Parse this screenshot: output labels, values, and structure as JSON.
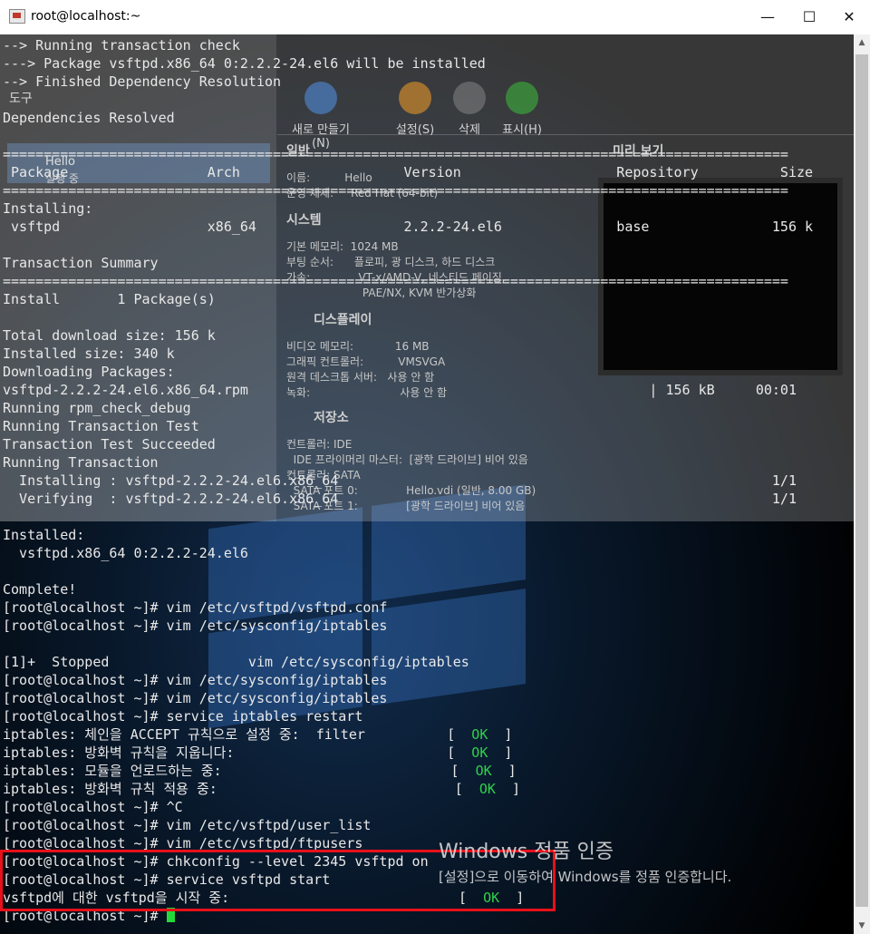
{
  "window": {
    "title": "root@localhost:~",
    "minimize": "—",
    "maximize": "☐",
    "close": "✕",
    "scroll_up": "▲",
    "scroll_down": "▼"
  },
  "terminal": {
    "lines": [
      "--> Running transaction check",
      "---> Package vsftpd.x86_64 0:2.2.2-24.el6 will be installed",
      "--> Finished Dependency Resolution",
      "",
      "Dependencies Resolved",
      "",
      "================================================================================================",
      " Package                 Arch                    Version                   Repository          Size",
      "================================================================================================",
      "Installing:",
      " vsftpd                  x86_64                  2.2.2-24.el6              base               156 k",
      "",
      "Transaction Summary",
      "================================================================================================",
      "Install       1 Package(s)",
      "",
      "Total download size: 156 k",
      "Installed size: 340 k",
      "Downloading Packages:",
      "vsftpd-2.2.2-24.el6.x86_64.rpm                                                 | 156 kB     00:01",
      "Running rpm_check_debug",
      "Running Transaction Test",
      "Transaction Test Succeeded",
      "Running Transaction",
      "  Installing : vsftpd-2.2.2-24.el6.x86_64                                                     1/1",
      "  Verifying  : vsftpd-2.2.2-24.el6.x86_64                                                     1/1",
      "",
      "Installed:",
      "  vsftpd.x86_64 0:2.2.2-24.el6",
      "",
      "Complete!",
      "[root@localhost ~]# vim /etc/vsftpd/vsftpd.conf",
      "[root@localhost ~]# vim /etc/sysconfig/iptables",
      "",
      "[1]+  Stopped                 vim /etc/sysconfig/iptables",
      "[root@localhost ~]# vim /etc/sysconfig/iptables",
      "[root@localhost ~]# vim /etc/sysconfig/iptables",
      "[root@localhost ~]# service iptables restart"
    ],
    "iptables_lines": [
      "iptables: 체인을 ACCEPT 규칙으로 설정 중:  filter          [  ",
      "iptables: 방화벽 규칙을 지웁니다:                          [  ",
      "iptables: 모듈을 언로드하는 중:                            [  ",
      "iptables: 방화벽 규칙 적용 중:                             [  "
    ],
    "after_iptables": [
      "[root@localhost ~]# ^C",
      "[root@localhost ~]# vim /etc/vsftpd/user_list",
      "[root@localhost ~]# vim /etc/vsftpd/ftpusers",
      "[root@localhost ~]# chkconfig --level 2345 vsftpd on",
      "[root@localhost ~]# service vsftpd start"
    ],
    "start_line": "vsftpd에 대한 vsftpd을 시작 중:                            [  ",
    "ok_label": "OK",
    "ok_close": "  ]",
    "prompt": "[root@localhost ~]# "
  },
  "overlay": {
    "tools_label": "도구",
    "vm_name": "Hello",
    "vm_state": "실행 중",
    "toolbar": [
      "새로 만들기(N)",
      "설정(S)",
      "삭제",
      "표시(H)"
    ],
    "general_title": "일반",
    "general_text": "이름:          Hello\n운영 체제:     Red Hat (64-bit)",
    "system_title": "시스템",
    "system_text": "기본 메모리:  1024 MB\n부팅 순서:      플로피, 광 디스크, 하드 디스크\n가속:              VT-x/AMD-V, 네스티드 페이징,\n                      PAE/NX, KVM 반가상화",
    "display_title": "디스플레이",
    "display_text": "비디오 메모리:            16 MB\n그래픽 컨트롤러:          VMSVGA\n원격 데스크톱 서버:   사용 안 함\n녹화:                          사용 안 함",
    "storage_title": "저장소",
    "storage_text": "컨트롤러: IDE\n  IDE 프라이머리 마스터:  [광학 드라이브] 비어 있음\n컨트롤러: SATA\n  SATA 포트 0:              Hello.vdi (일반, 8.00 GB)\n  SATA 포트 1:              [광학 드라이브] 비어 있음",
    "preview_title": "미리 보기"
  },
  "activation": {
    "title": "Windows 정품 인증",
    "subtitle": "[설정]으로 이동하여 Windows를 정품 인증합니다."
  }
}
